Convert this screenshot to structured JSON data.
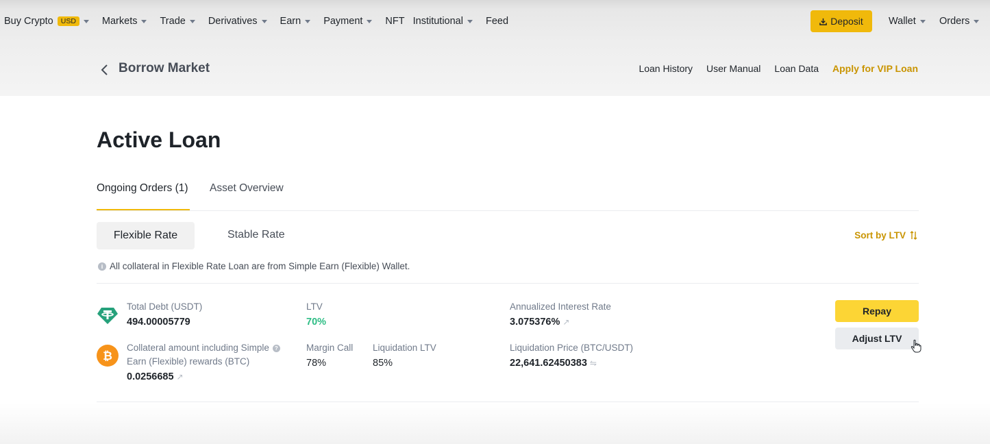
{
  "nav": {
    "items": [
      {
        "label": "Buy Crypto",
        "badge": "USD",
        "caret": true
      },
      {
        "label": "Markets",
        "caret": true
      },
      {
        "label": "Trade",
        "caret": true
      },
      {
        "label": "Derivatives",
        "caret": true
      },
      {
        "label": "Earn",
        "caret": true
      },
      {
        "label": "Payment",
        "caret": true
      },
      {
        "label": "NFT",
        "caret": false
      },
      {
        "label": "Institutional",
        "caret": true
      },
      {
        "label": "Feed",
        "caret": false
      }
    ],
    "deposit_label": "Deposit",
    "wallet_label": "Wallet",
    "orders_label": "Orders"
  },
  "subheader": {
    "title": "Borrow Market",
    "links": [
      "Loan History",
      "User Manual",
      "Loan Data",
      "Apply for VIP Loan"
    ]
  },
  "main": {
    "title": "Active Loan",
    "tabs": [
      "Ongoing Orders (1)",
      "Asset Overview"
    ],
    "rate_tabs": [
      "Flexible Rate",
      "Stable Rate"
    ],
    "sort_label": "Sort by LTV",
    "info_text": "All collateral in Flexible Rate Loan are from Simple Earn (Flexible) Wallet."
  },
  "loan": {
    "total_debt_label": "Total Debt (USDT)",
    "total_debt_value": "494.00005779",
    "ltv_label": "LTV",
    "ltv_value": "70%",
    "interest_label": "Annualized Interest Rate",
    "interest_value": "3.075376%",
    "collateral_label_line1": "Collateral amount including Simple",
    "collateral_label_line2": "Earn (Flexible) rewards (BTC)",
    "collateral_value": "0.0256685",
    "margin_call_label": "Margin Call",
    "margin_call_value": "78%",
    "liq_ltv_label": "Liquidation LTV",
    "liq_ltv_value": "85%",
    "liq_price_label": "Liquidation Price (BTC/USDT)",
    "liq_price_value": "22,641.62450383",
    "repay_label": "Repay",
    "adjust_label": "Adjust LTV"
  },
  "colors": {
    "accent": "#f0b90b",
    "ltv_green": "#2ebd85",
    "tether": "#26a17b",
    "bitcoin": "#f7931a"
  }
}
